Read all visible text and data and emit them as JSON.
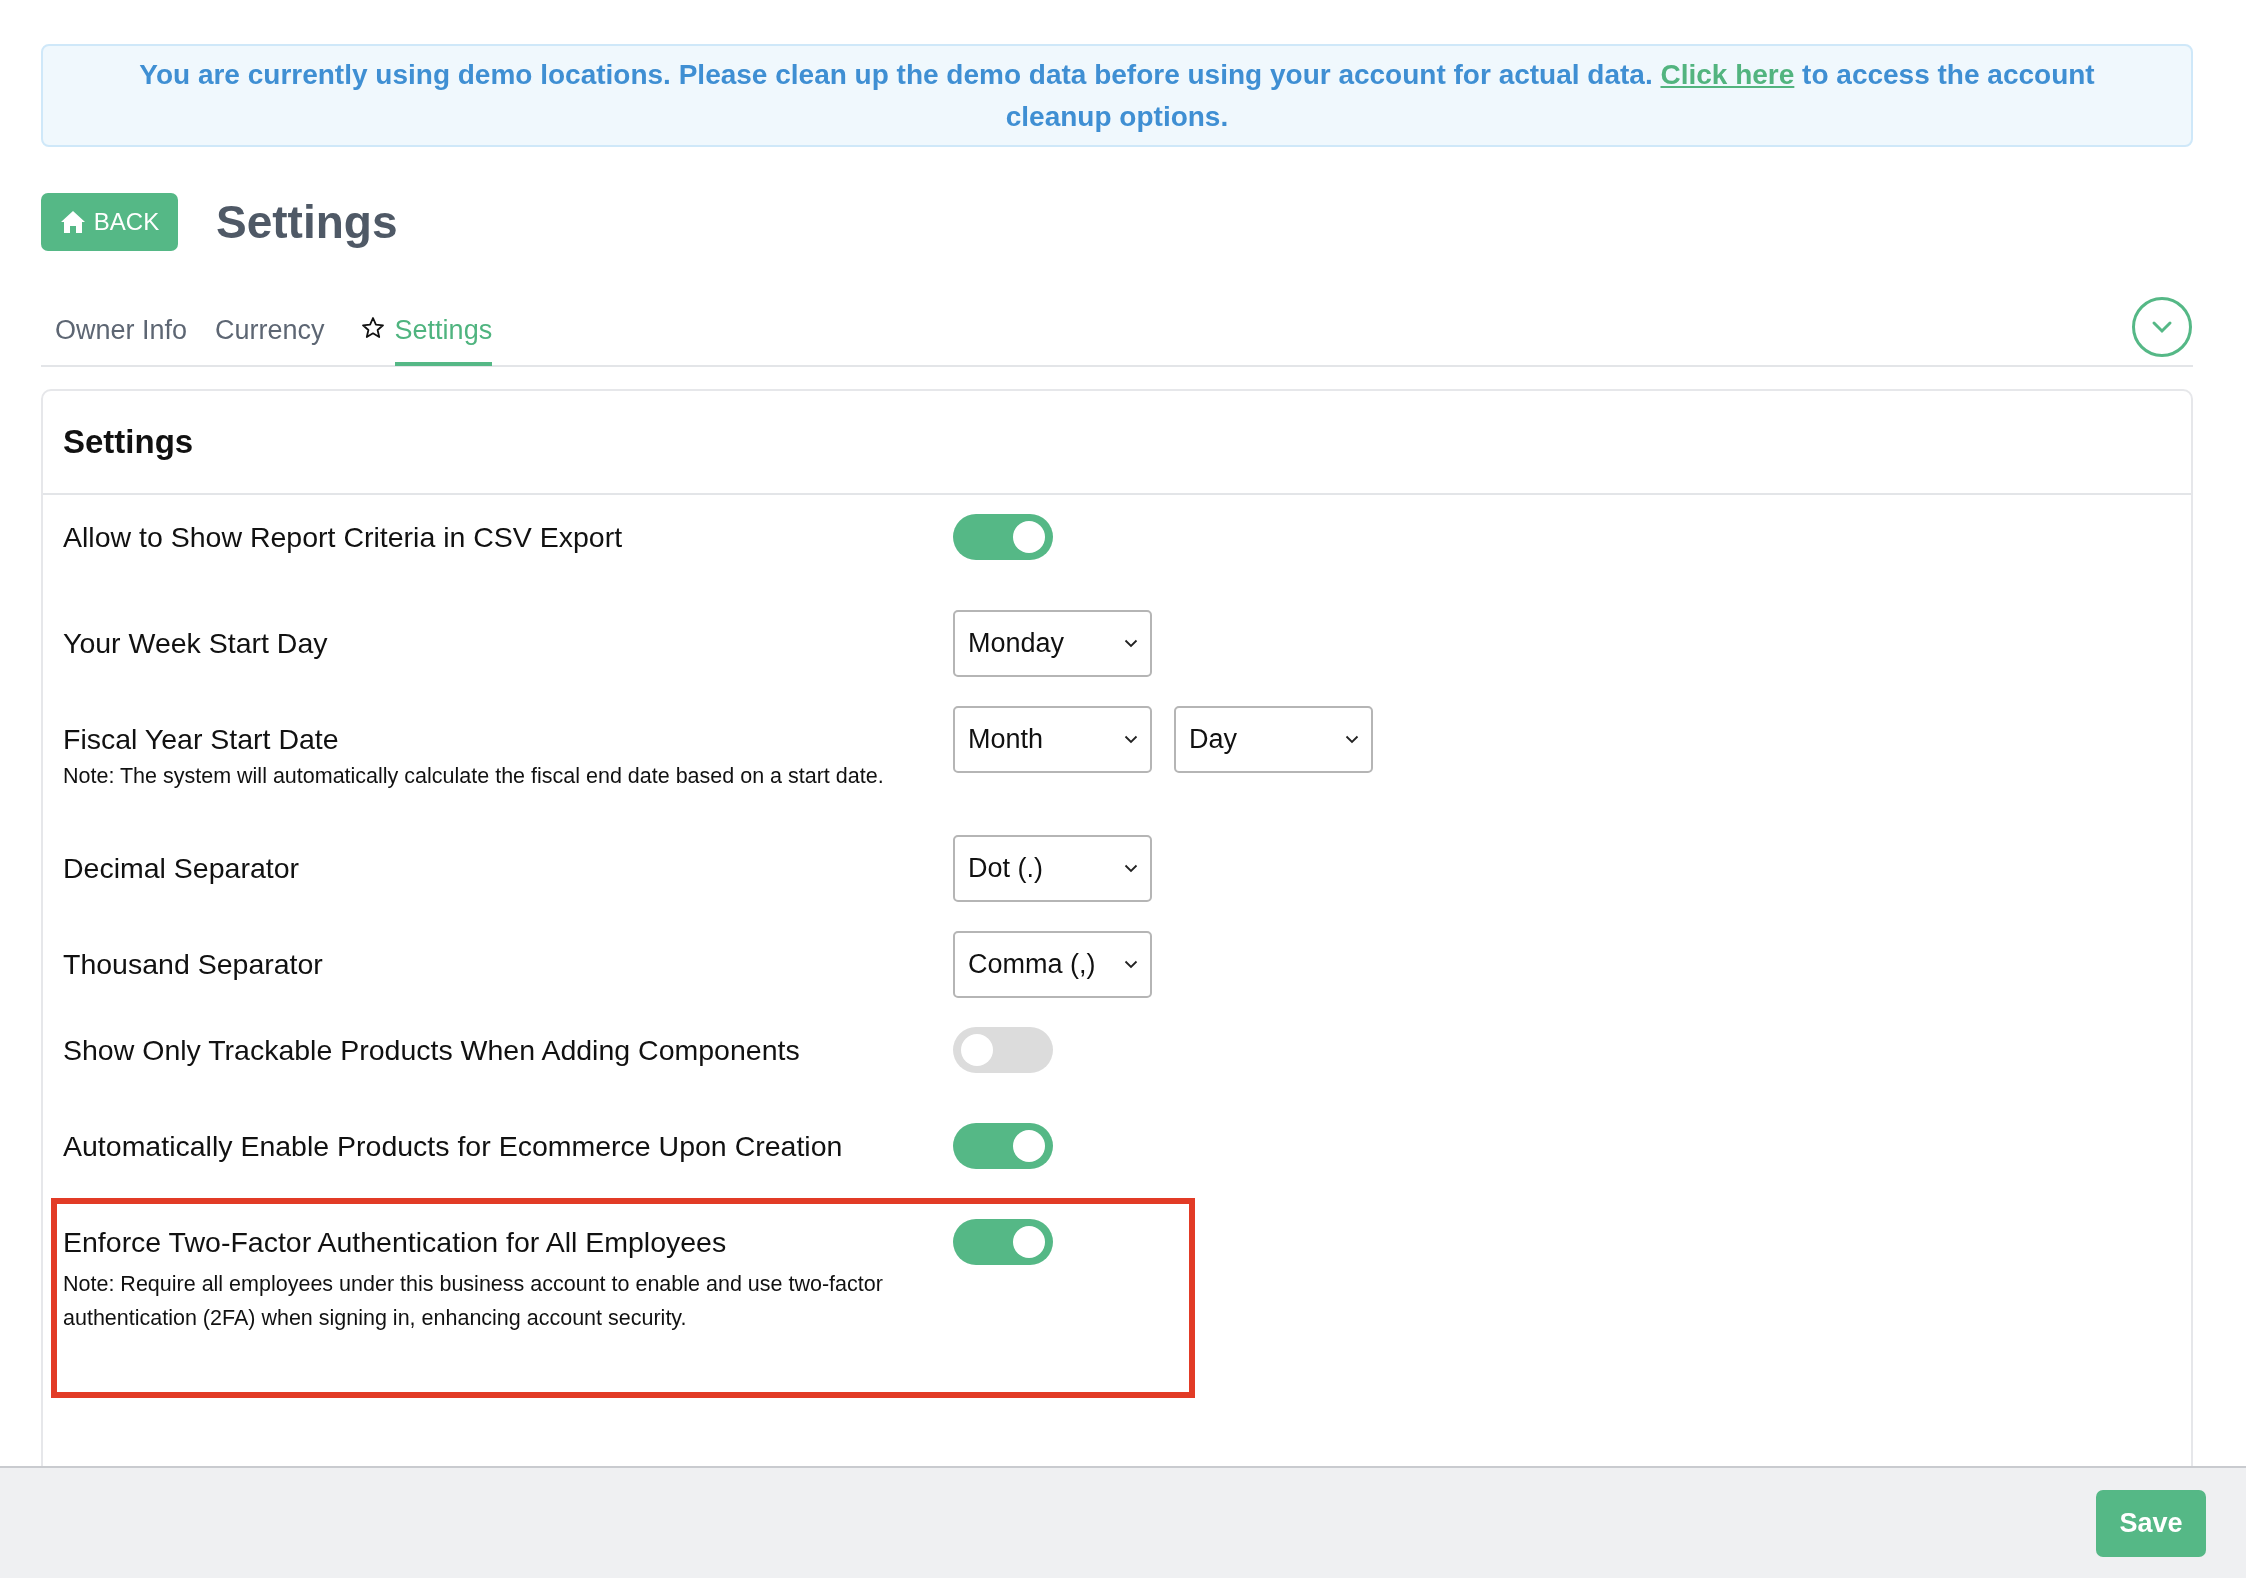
{
  "banner": {
    "text_before": "You are currently using demo locations. Please clean up the demo data before using your account for actual data.",
    "link": "Click here",
    "text_after": "to access the account cleanup options."
  },
  "header": {
    "back_button": "BACK",
    "title": "Settings"
  },
  "tabs": [
    {
      "label": "Owner Info",
      "selected": false,
      "starred": false
    },
    {
      "label": "Currency",
      "selected": false,
      "starred": false
    },
    {
      "label": "Settings",
      "selected": true,
      "starred": true
    }
  ],
  "panel": {
    "title": "Settings",
    "rows": [
      {
        "kind": "toggle",
        "label": "Allow to Show Report Criteria in CSV Export",
        "on": true,
        "highlighted": false
      },
      {
        "kind": "select",
        "label": "Your Week Start Day",
        "selects": [
          "Monday"
        ],
        "highlighted": false
      },
      {
        "kind": "select",
        "label": "Fiscal Year Start Date",
        "note": "Note: The system will automatically calculate the fiscal end date based on a start date.",
        "selects": [
          "Month",
          "Day"
        ],
        "highlighted": false
      },
      {
        "kind": "select",
        "label": "Decimal Separator",
        "selects": [
          "Dot (.)"
        ],
        "highlighted": false
      },
      {
        "kind": "select",
        "label": "Thousand Separator",
        "selects": [
          "Comma (,)"
        ],
        "highlighted": false
      },
      {
        "kind": "toggle",
        "label": "Show Only Trackable Products When Adding Components",
        "on": false,
        "highlighted": false
      },
      {
        "kind": "toggle",
        "label": "Automatically Enable Products for Ecommerce Upon Creation",
        "on": true,
        "highlighted": false
      },
      {
        "kind": "toggle",
        "label": "Enforce Two-Factor Authentication for All Employees",
        "note": "Note: Require all employees under this business account to enable and use two-factor authentication (2FA) when signing in, enhancing account security.",
        "on": true,
        "highlighted": true
      }
    ]
  },
  "footer": {
    "save_button": "Save"
  }
}
